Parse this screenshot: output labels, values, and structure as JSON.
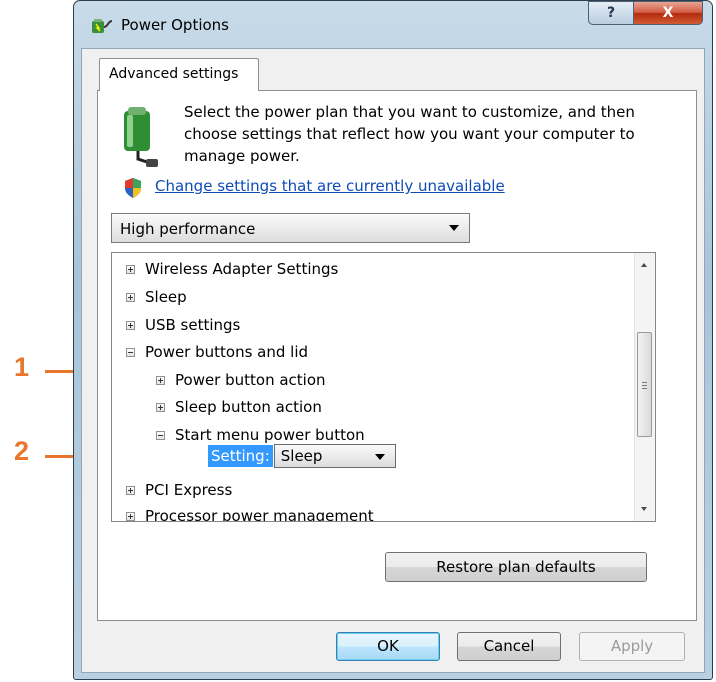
{
  "window": {
    "title": "Power Options",
    "help_button": "?",
    "close_button": "X"
  },
  "tab": {
    "label": "Advanced settings"
  },
  "description": "Select the power plan that you want to customize, and then choose settings that reflect how you want your computer to manage power.",
  "change_link": "Change settings that are currently unavailable",
  "plan_select": {
    "value": "High performance"
  },
  "tree": {
    "items": [
      {
        "label": "Wireless Adapter Settings",
        "expanded": false,
        "level": 0
      },
      {
        "label": "Sleep",
        "expanded": false,
        "level": 0
      },
      {
        "label": "USB settings",
        "expanded": false,
        "level": 0
      },
      {
        "label": "Power buttons and lid",
        "expanded": true,
        "level": 0
      },
      {
        "label": "Power button action",
        "expanded": false,
        "level": 1
      },
      {
        "label": "Sleep button action",
        "expanded": false,
        "level": 1
      },
      {
        "label": "Start menu power button",
        "expanded": true,
        "level": 1
      },
      {
        "label": "PCI Express",
        "expanded": false,
        "level": 0
      },
      {
        "label": "Processor power management",
        "expanded": false,
        "level": 0
      }
    ],
    "setting": {
      "label": "Setting:",
      "value": "Sleep"
    }
  },
  "buttons": {
    "restore": "Restore plan defaults",
    "ok": "OK",
    "cancel": "Cancel",
    "apply": "Apply"
  },
  "callouts": [
    "1",
    "2"
  ],
  "colors": {
    "callout": "#e8762d",
    "link": "#0f4bb8",
    "selection": "#3399ff"
  }
}
